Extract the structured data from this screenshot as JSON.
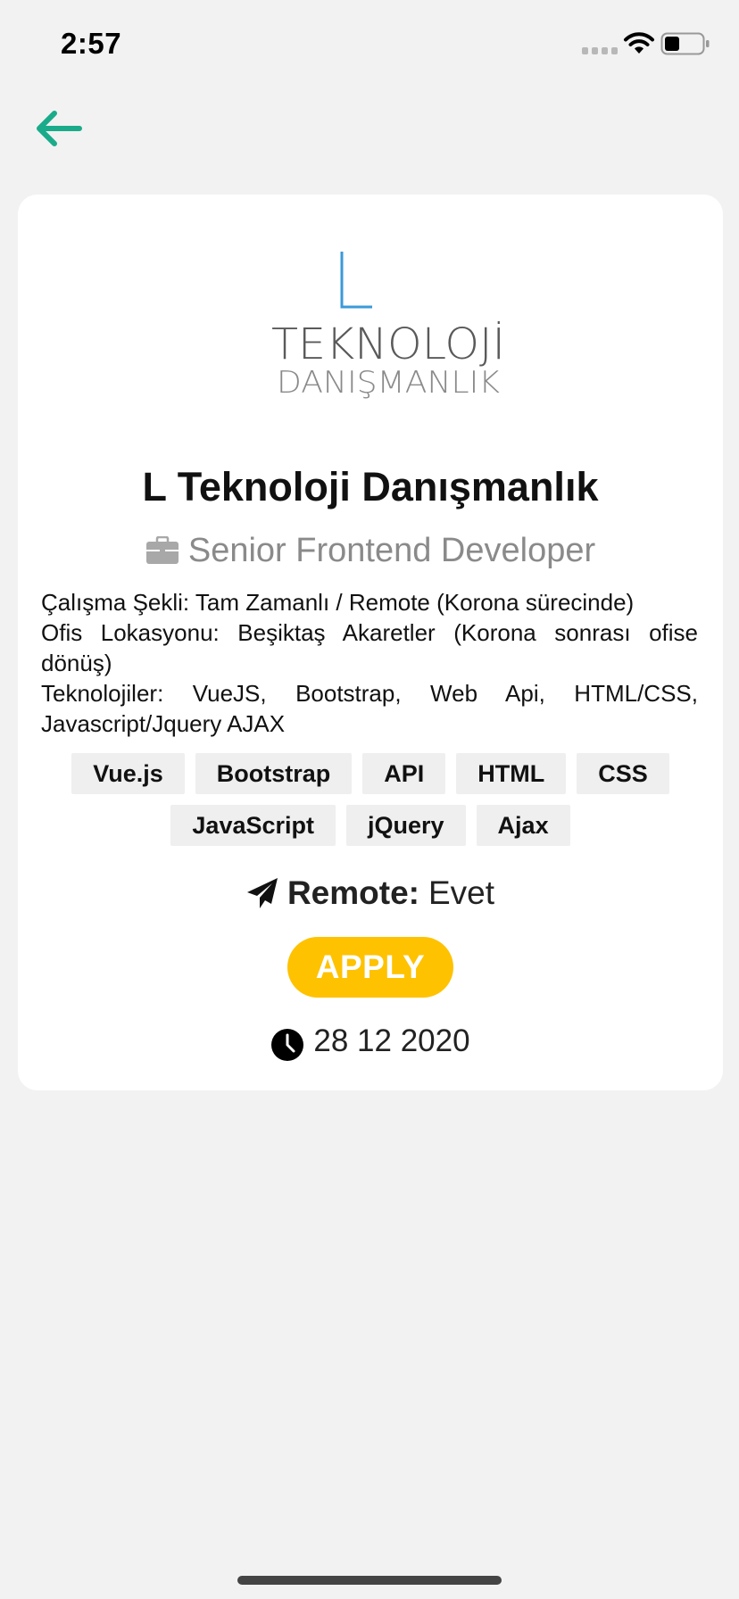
{
  "status_bar": {
    "time": "2:57"
  },
  "navigation": {
    "back_icon": "arrow-left-icon",
    "accent_color": "#1aab8a"
  },
  "job": {
    "logo": {
      "mark": "L",
      "line1": "TEKNOLOJİ",
      "line2": "DANIŞMANLIK"
    },
    "company_name": "L Teknoloji Danışmanlık",
    "title_icon": "briefcase-icon",
    "title": "Senior Frontend Developer",
    "description": [
      "Çalışma Şekli: Tam Zamanlı / Remote (Korona sürecinde)",
      "Ofis Lokasyonu: Beşiktaş Akaretler (Korona sonrası ofise dönüş)",
      "Teknolojiler: VueJS, Bootstrap, Web Api, HTML/CSS, Javascript/Jquery AJAX"
    ],
    "tags": [
      "Vue.js",
      "Bootstrap",
      "API",
      "HTML",
      "CSS",
      "JavaScript",
      "jQuery",
      "Ajax"
    ],
    "remote": {
      "icon": "paper-plane-icon",
      "label": "Remote:",
      "value": "Evet"
    },
    "apply_label": "APPLY",
    "apply_color": "#fec200",
    "date": {
      "icon": "clock-icon",
      "value": "28 12 2020"
    }
  }
}
